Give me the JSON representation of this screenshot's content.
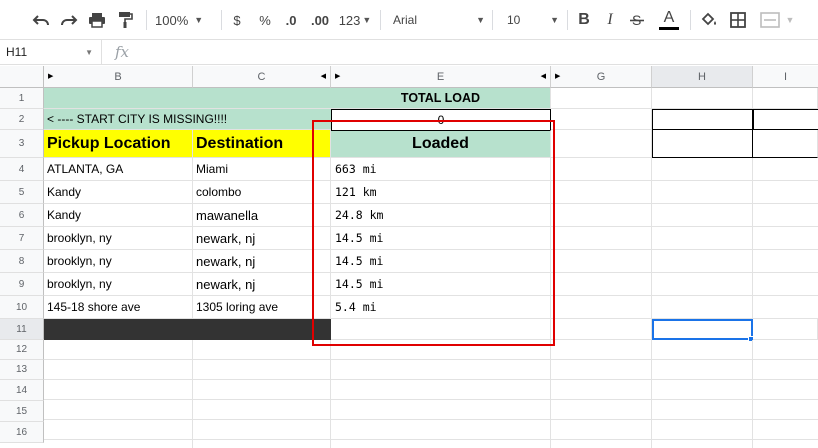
{
  "toolbar": {
    "zoom": "100%",
    "currency": "$",
    "percent": "%",
    "decimal_decrease": ".0",
    "decimal_increase": ".00",
    "more_formats": "123",
    "font": "Arial",
    "font_size": "10",
    "bold": "B",
    "italic": "I",
    "text_color": "A"
  },
  "formula_bar": {
    "name_box": "H11",
    "fx_label": "fx"
  },
  "columns": [
    "B",
    "C",
    "E",
    "G",
    "H",
    "I"
  ],
  "rows": [
    "1",
    "2",
    "3",
    "4",
    "5",
    "6",
    "7",
    "8",
    "9",
    "10",
    "11",
    "12",
    "13",
    "14",
    "15",
    "16"
  ],
  "cells": {
    "e1": "TOTAL LOAD",
    "b2": "< ---- START CITY IS MISSING!!!!",
    "e2": "0",
    "b3": "Pickup Location",
    "c3": "Destination",
    "e3": "Loaded",
    "b4": "ATLANTA, GA",
    "c4": "Miami",
    "e4": "663 mi",
    "b5": "Kandy",
    "c5": "colombo",
    "e5": "121 km",
    "b6": "Kandy",
    "c6": "mawanella",
    "e6": "24.8 km",
    "b7": "brooklyn, ny",
    "c7": "newark, nj",
    "e7": "14.5 mi",
    "b8": "brooklyn, ny",
    "c8": "newark, nj",
    "e8": "14.5 mi",
    "b9": "brooklyn, ny",
    "c9": "newark, nj",
    "e9": "14.5 mi",
    "b10": "145-18 shore ave",
    "c10": "1305 loring ave",
    "e10": "5.4 mi"
  },
  "colors": {
    "header_green": "#b7e1cd",
    "header_yellow": "#ffff00",
    "row11_dark": "#333333",
    "annotation_red": "#e00000",
    "selection_blue": "#1a73e8"
  }
}
